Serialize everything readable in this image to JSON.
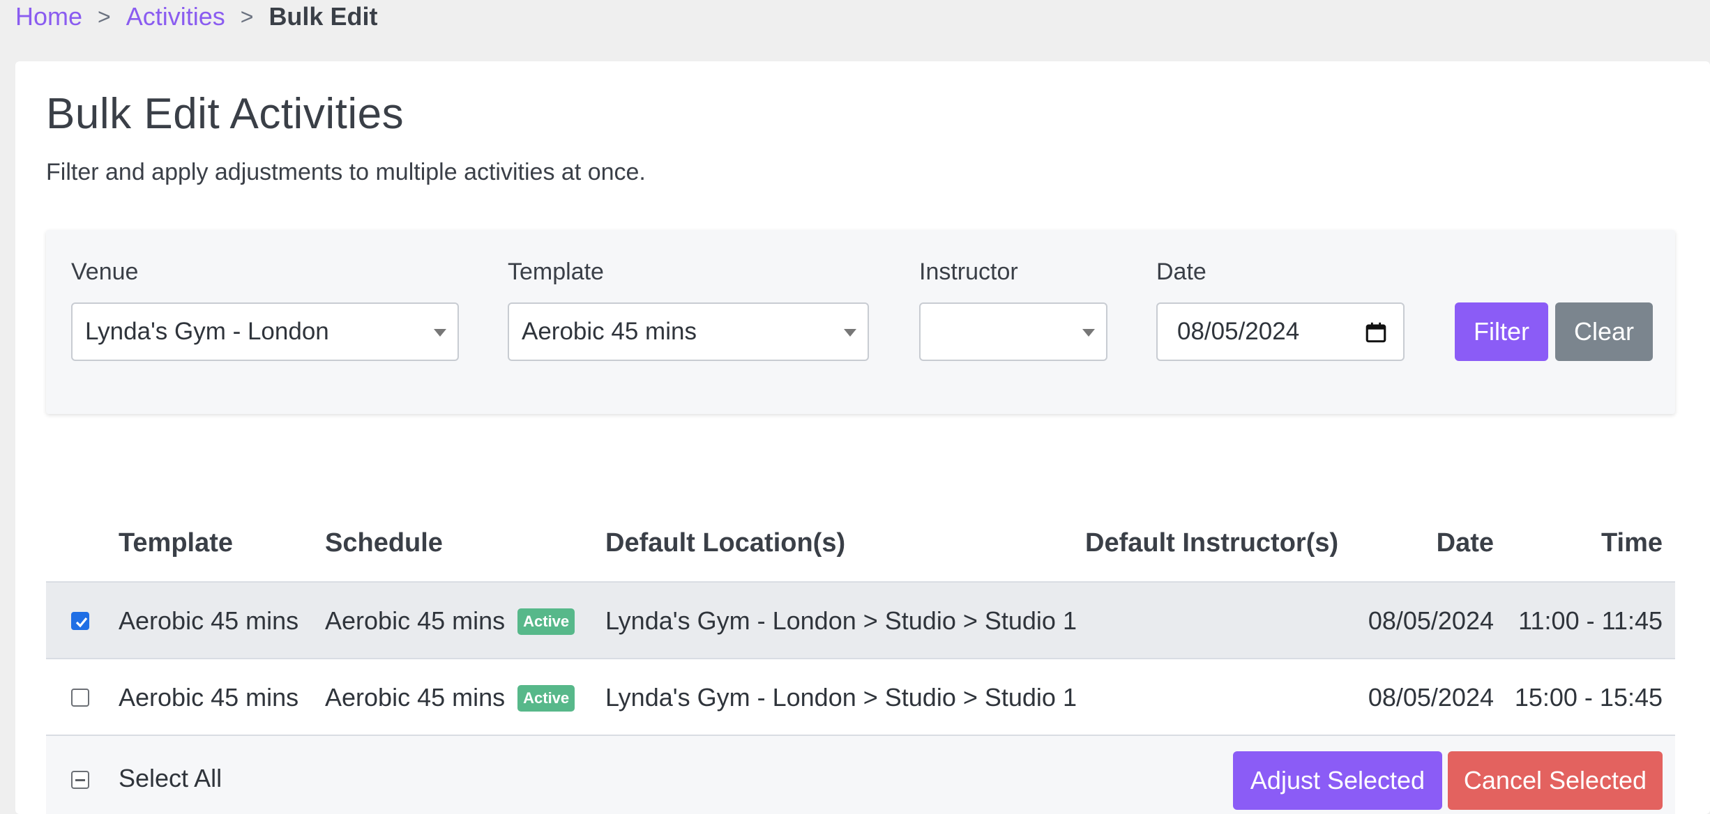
{
  "breadcrumb": {
    "home": "Home",
    "activities": "Activities",
    "current": "Bulk Edit",
    "separator": ">"
  },
  "page": {
    "title": "Bulk Edit Activities",
    "subtitle": "Filter and apply adjustments to multiple activities at once."
  },
  "filters": {
    "venue_label": "Venue",
    "venue_value": "Lynda's Gym - London",
    "template_label": "Template",
    "template_value": "Aerobic 45 mins",
    "instructor_label": "Instructor",
    "instructor_value": "",
    "date_label": "Date",
    "date_value": "08/05/2024",
    "filter_button": "Filter",
    "clear_button": "Clear"
  },
  "table": {
    "headers": {
      "template": "Template",
      "schedule": "Schedule",
      "locations": "Default Location(s)",
      "instructors": "Default Instructor(s)",
      "date": "Date",
      "time": "Time"
    },
    "rows": [
      {
        "checked": true,
        "template": "Aerobic 45 mins",
        "schedule": "Aerobic 45 mins",
        "badge": "Active",
        "location": "Lynda's Gym - London > Studio > Studio 1",
        "instructor": "",
        "date": "08/05/2024",
        "time": "11:00 - 11:45"
      },
      {
        "checked": false,
        "template": "Aerobic 45 mins",
        "schedule": "Aerobic 45 mins",
        "badge": "Active",
        "location": "Lynda's Gym - London > Studio > Studio 1",
        "instructor": "",
        "date": "08/05/2024",
        "time": "15:00 - 15:45"
      }
    ],
    "select_all_label": "Select All",
    "adjust_button": "Adjust Selected",
    "cancel_button": "Cancel Selected"
  },
  "colors": {
    "accent": "#8b5cf6",
    "clear_button": "#7b858e",
    "cancel_button": "#e3625f",
    "badge": "#57b88a",
    "link": "#8a5cf0"
  },
  "icons": {
    "date_picker": "calendar-icon",
    "select_caret": "chevron-down-icon",
    "row_checkbox_checked": "checkmark-icon"
  }
}
